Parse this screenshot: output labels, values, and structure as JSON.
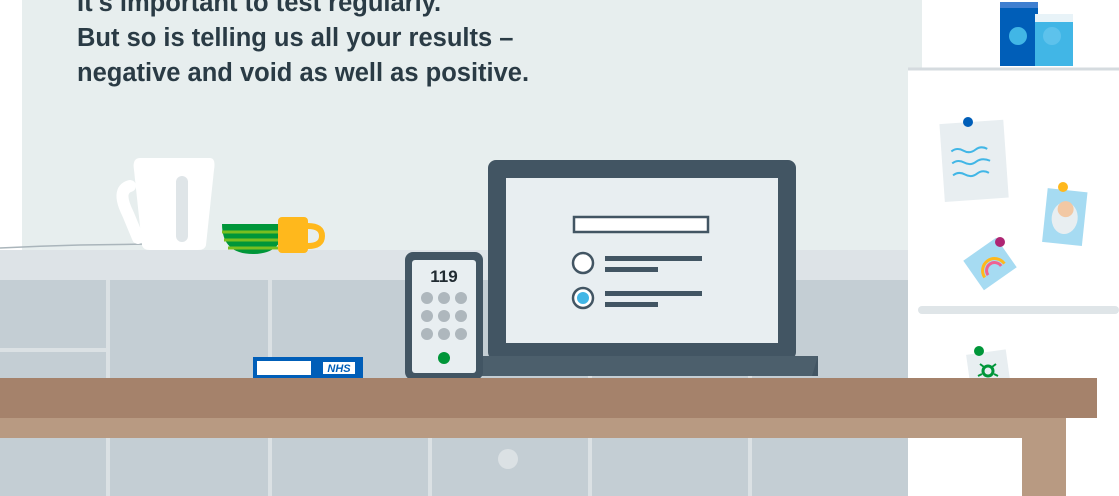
{
  "headline": {
    "line1": "It's important to test regularly.",
    "line2": "But so is telling us all your results –",
    "line3": "negative and void as well as positive."
  },
  "phone": {
    "number": "119"
  },
  "card": {
    "logo": "NHS"
  },
  "colors": {
    "wall": "#e7eeee",
    "cabinets": "#c4ced4",
    "table_top": "#a5826b",
    "nhs_blue": "#005eb8",
    "accent_blue": "#41b6e6",
    "green": "#009639",
    "text": "#2a3b45"
  }
}
